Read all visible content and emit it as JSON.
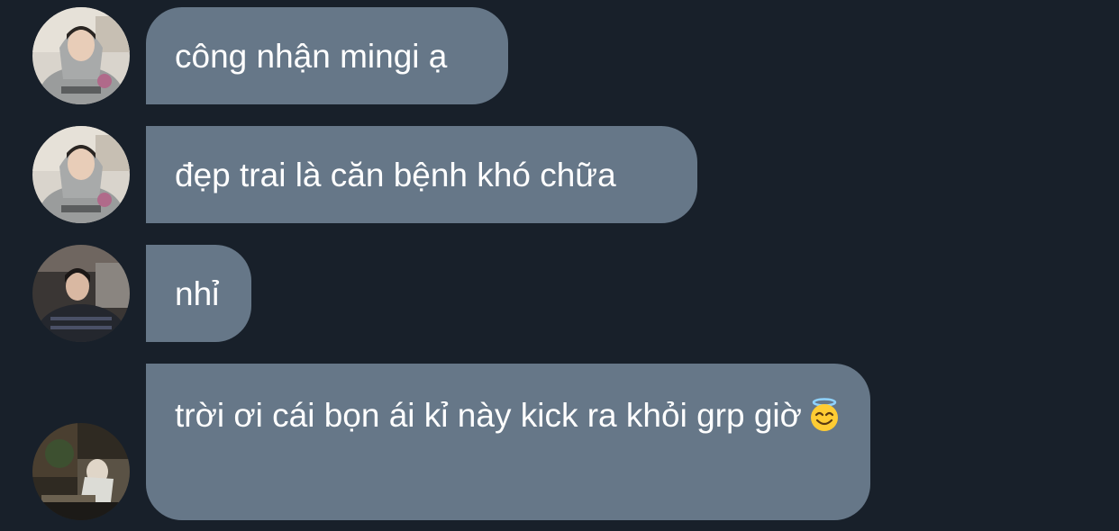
{
  "messages": [
    {
      "avatar": "avatar-hoodie-guy",
      "text": "công nhận mingi ạ"
    },
    {
      "avatar": "avatar-hoodie-guy",
      "text": "đẹp trai là căn bệnh khó chữa"
    },
    {
      "avatar": "avatar-dark-sweater-guy",
      "text": "nhỉ"
    },
    {
      "avatar": "avatar-sitting-guy",
      "text": "trời ơi cái bọn ái kỉ này kick ra khỏi grp giờ",
      "emoji": "smiling-face-with-halo-emoji"
    }
  ],
  "colors": {
    "background": "#18202a",
    "bubble": "#667788",
    "text": "#ffffff"
  }
}
